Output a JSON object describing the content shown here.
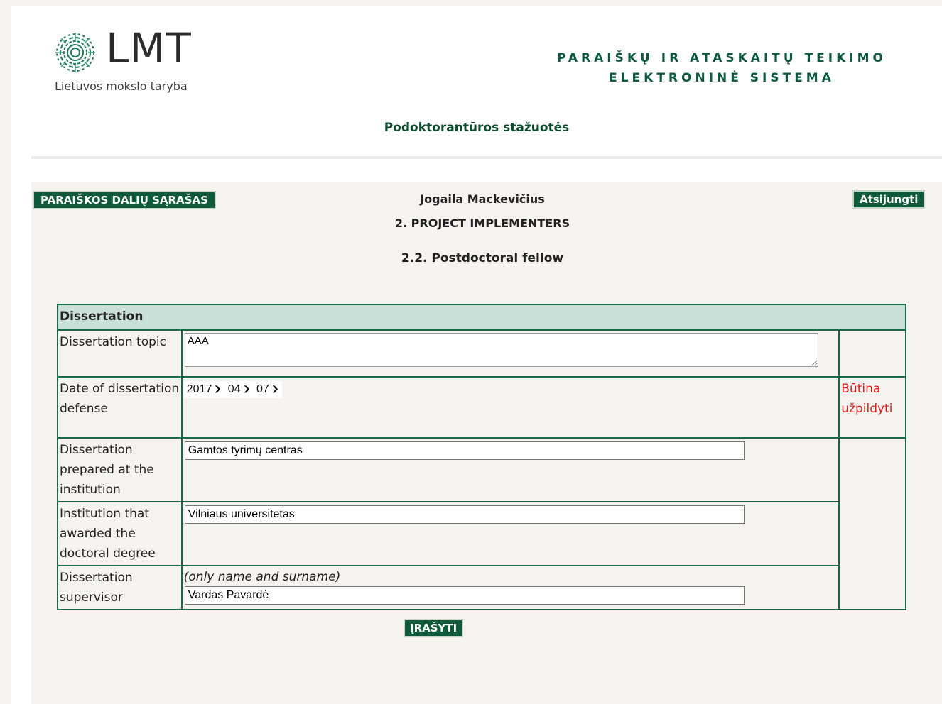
{
  "header": {
    "logo_text": "LMT",
    "logo_subtitle": "Lietuvos mokslo taryba",
    "system_title_line1": "PARAIŠKŲ IR ATASKAITŲ TEIKIMO",
    "system_title_line2": "ELEKTRONINĖ SISTEMA",
    "program_title": "Podoktorantūros stažuotės"
  },
  "toolbar": {
    "parts_list_label": "PARAIŠKOS DALIŲ SĄRAŠAS",
    "user_name": "Jogaila Mackevičius",
    "logout_label": "Atsijungti"
  },
  "section": {
    "title": "2. PROJECT IMPLEMENTERS",
    "subtitle": "2.2. Postdoctoral fellow"
  },
  "form": {
    "group_header": "Dissertation",
    "topic_label": "Dissertation topic",
    "topic_value": "AAA",
    "date_label": "Date of dissertation defense",
    "date_year": "2017",
    "date_month": "04",
    "date_day": "07",
    "required_msg": "Būtina užpildyti",
    "prepared_label": "Dissertation prepared at the institution",
    "prepared_value": "Gamtos tyrimų centras",
    "awarded_label": "Institution that awarded the doctoral degree",
    "awarded_value": "Vilniaus universitetas",
    "supervisor_label": "Dissertation supervisor",
    "supervisor_hint": "(only name and surname)",
    "supervisor_value": "Vardas Pavardė",
    "save_label": "ĮRAŠYTI"
  },
  "colors": {
    "brand_green": "#0f5a3b",
    "header_row_bg": "#c9e0d9",
    "required_red": "#e41b1b"
  }
}
